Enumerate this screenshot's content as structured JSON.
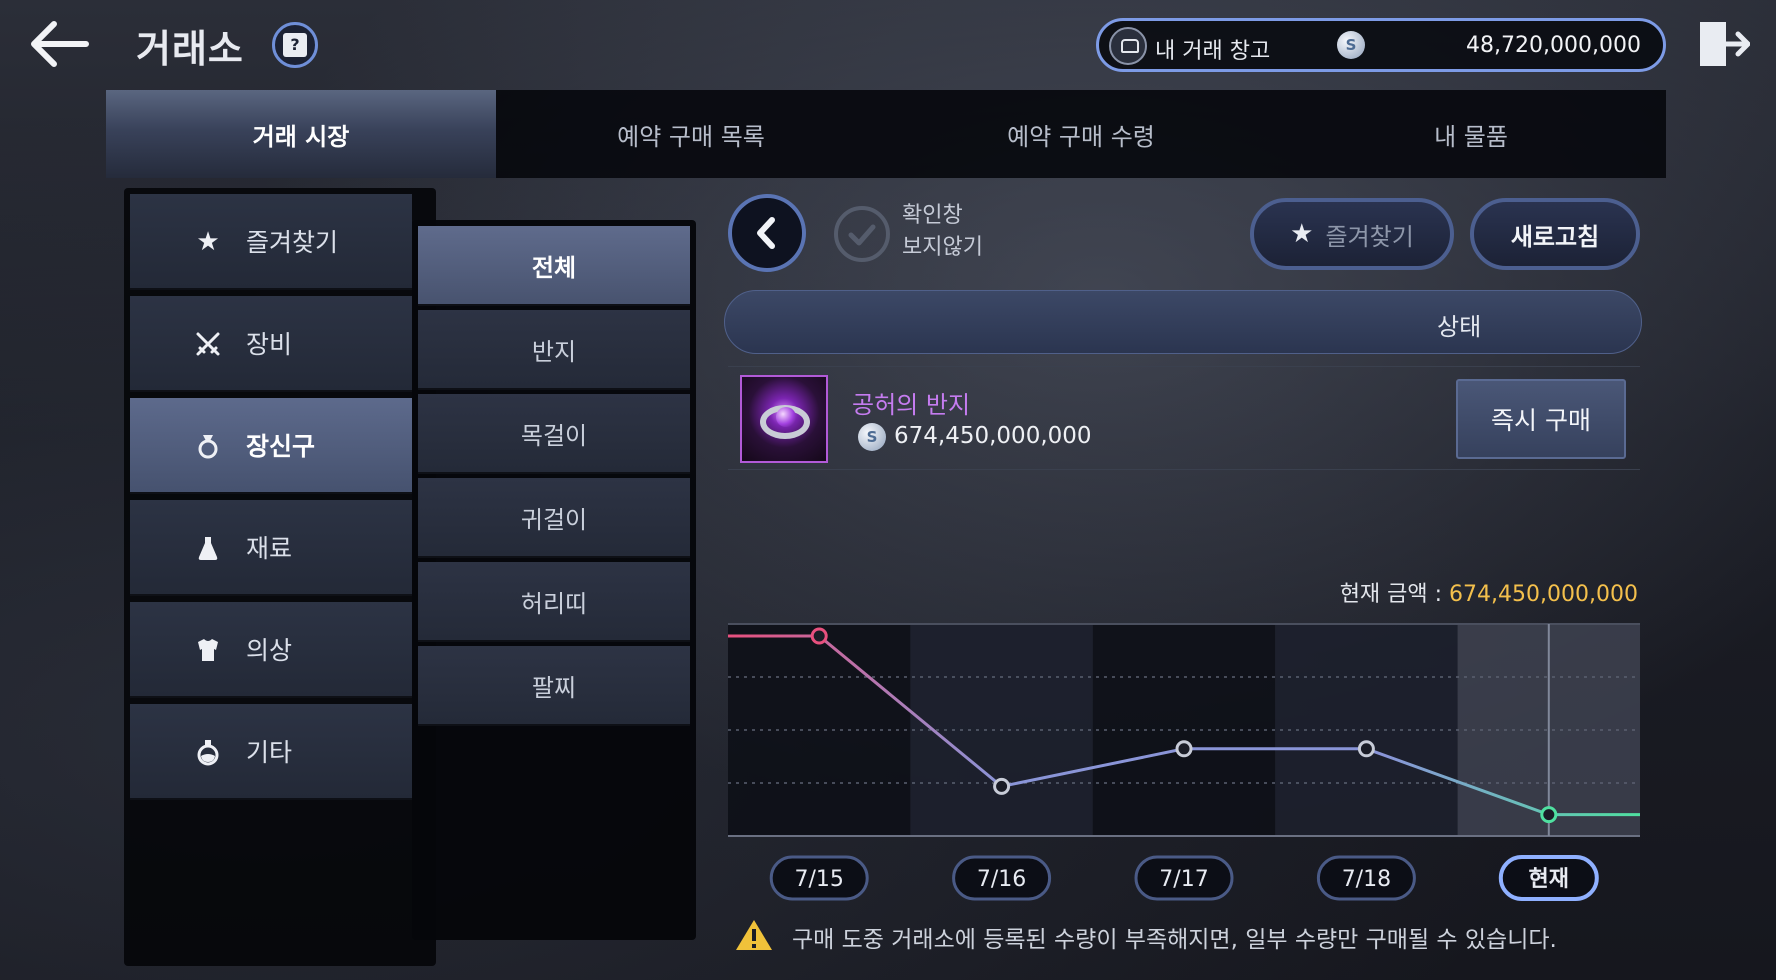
{
  "header": {
    "title": "거래소",
    "wallet_label": "내 거래 창고",
    "silver_symbol": "S",
    "balance": "48,720,000,000"
  },
  "tabs": [
    {
      "label": "거래 시장",
      "active": true
    },
    {
      "label": "예약 구매 목록",
      "active": false
    },
    {
      "label": "예약 구매 수령",
      "active": false
    },
    {
      "label": "내 물품",
      "active": false
    }
  ],
  "categories": [
    {
      "label": "즐겨찾기",
      "icon": "star-icon"
    },
    {
      "label": "장비",
      "icon": "crossed-swords-icon"
    },
    {
      "label": "장신구",
      "icon": "ring-icon",
      "active": true
    },
    {
      "label": "재료",
      "icon": "flask-icon"
    },
    {
      "label": "의상",
      "icon": "armor-icon"
    },
    {
      "label": "기타",
      "icon": "potion-icon"
    }
  ],
  "subcategories": [
    {
      "label": "전체",
      "active": true
    },
    {
      "label": "반지"
    },
    {
      "label": "목걸이"
    },
    {
      "label": "귀걸이"
    },
    {
      "label": "허리띠"
    },
    {
      "label": "팔찌"
    }
  ],
  "detail": {
    "confirm_toggle_line1": "확인창",
    "confirm_toggle_line2": "보지않기",
    "favorite_label": "즐겨찾기",
    "refresh_label": "새로고침",
    "status_header": "상태",
    "item_name": "공허의 반지",
    "item_price": "674,450,000,000",
    "buy_now_label": "즉시 구매",
    "current_price_label": "현재 금액 : ",
    "current_price_value": "674,450,000,000",
    "warning": "구매 도중 거래소에 등록된 수량이 부족해지면, 일부 수량만 구매될 수 있습니다."
  },
  "colors": {
    "accent": "#7d9be6",
    "price_gold": "#f4c04c",
    "item_purple": "#c57cf0",
    "line_start": "#e8507e",
    "line_mid": "#8a95d8",
    "line_end": "#4fe0a0"
  },
  "chart_data": {
    "type": "line",
    "categories": [
      "7/15",
      "7/16",
      "7/17",
      "7/18",
      "현재"
    ],
    "values": [
      5,
      1,
      2,
      2,
      0.25
    ],
    "note": "relative price trend; no numeric y axis shown"
  }
}
